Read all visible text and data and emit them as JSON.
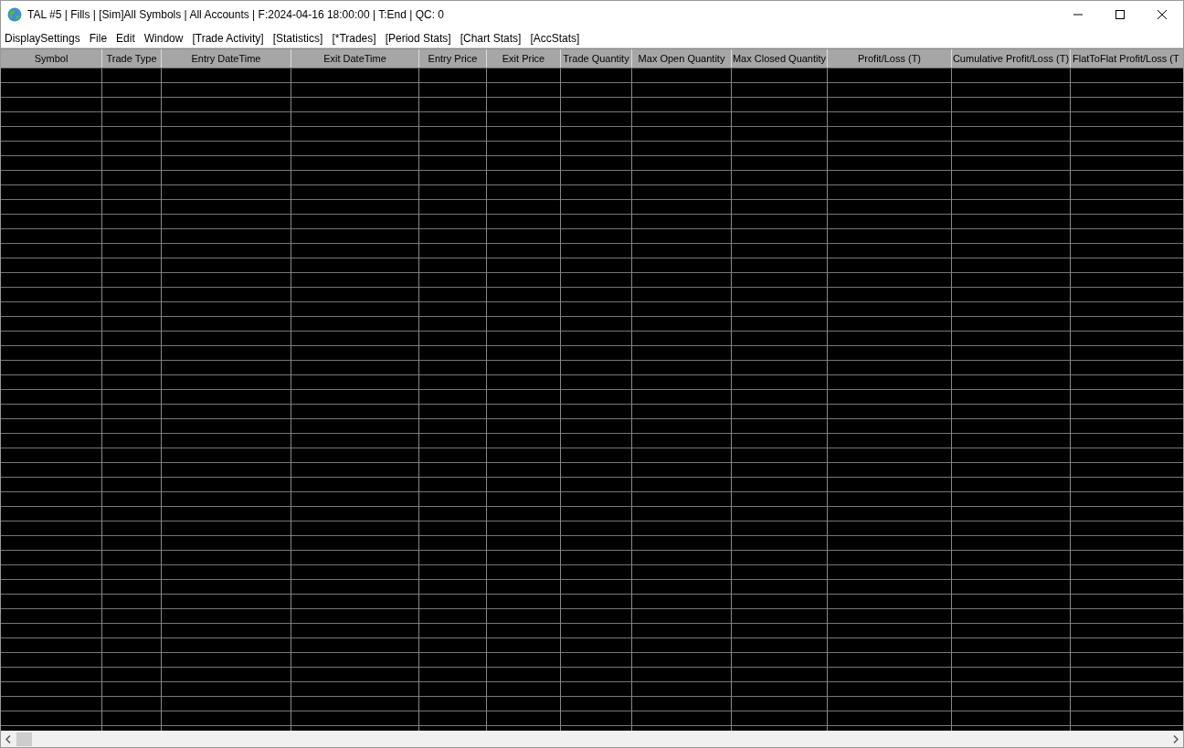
{
  "window": {
    "title": "TAL #5 | Fills | [Sim]All Symbols | All Accounts | F:2024-04-16  18:00:00 | T:End | QC: 0"
  },
  "menu": [
    "DisplaySettings",
    "File",
    "Edit",
    "Window",
    "[Trade Activity]",
    "[Statistics]",
    "[*Trades]",
    "[Period Stats]",
    "[Chart Stats]",
    "[AccStats]"
  ],
  "table": {
    "columns": [
      "Symbol",
      "Trade Type",
      "Entry DateTime",
      "Exit DateTime",
      "Entry Price",
      "Exit Price",
      "Trade Quantity",
      "Max Open Quantity",
      "Max Closed Quantity",
      "Profit/Loss (T)",
      "Cumulative Profit/Loss (T)",
      "FlatToFlat Profit/Loss (T"
    ]
  }
}
